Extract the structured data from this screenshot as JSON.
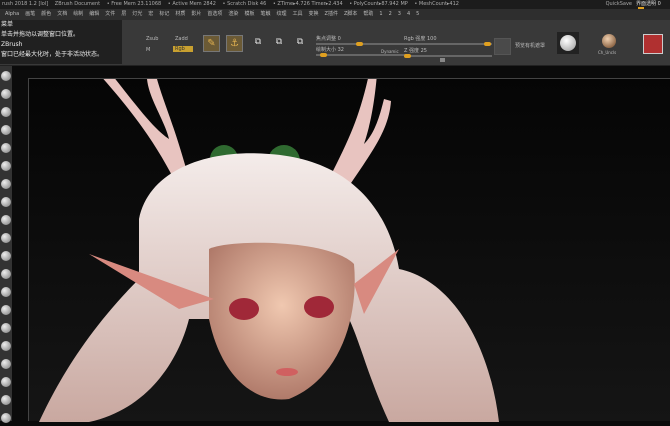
{
  "title_bar": {
    "items": [
      "rush 2018 1.2 [lol]",
      "ZBrush Document",
      "• Free Mem 23.11068",
      "• Active Mem 2842",
      "• Scratch Disk 46",
      "• ZTime▸4.726 Timer▸2.434",
      "• PolyCount▸87.942 MP",
      "• MeshCount▸412"
    ],
    "quicksave": "QuickSave",
    "transparency": "界面透明 0"
  },
  "menu": [
    "Alpha",
    "画笔",
    "颜色",
    "文档",
    "绘制",
    "编辑",
    "文件",
    "层",
    "灯光",
    "宏",
    "标记",
    "材质",
    "影片",
    "首选项",
    "渲染",
    "模板",
    "笔触",
    "纹理",
    "工具",
    "变换",
    "Z插件",
    "Z脚本",
    "帮助",
    "1",
    "2",
    "3",
    "4",
    "5"
  ],
  "tooltip": [
    "菜单",
    "单击并拖动以调整窗口位置。",
    "ZBrush",
    "窗口已经最大化时，处于非活动状态。"
  ],
  "shelf": {
    "zsub": "Zsub",
    "zadd": "Zadd",
    "m": "M",
    "rgb": "Rgb",
    "rgb_intensity_label": "Rgb 强度 100",
    "z_intensity_label": "Z 强度 25",
    "focal_shift_label": "焦点调整 0",
    "draw_size_label": "绘制大小 32",
    "dynamic": "Dynamic",
    "persp": "预览有机遮罩",
    "material_label": "Ch_Uncls",
    "accent": "#e0a020",
    "color_swatch": "#b03030"
  }
}
